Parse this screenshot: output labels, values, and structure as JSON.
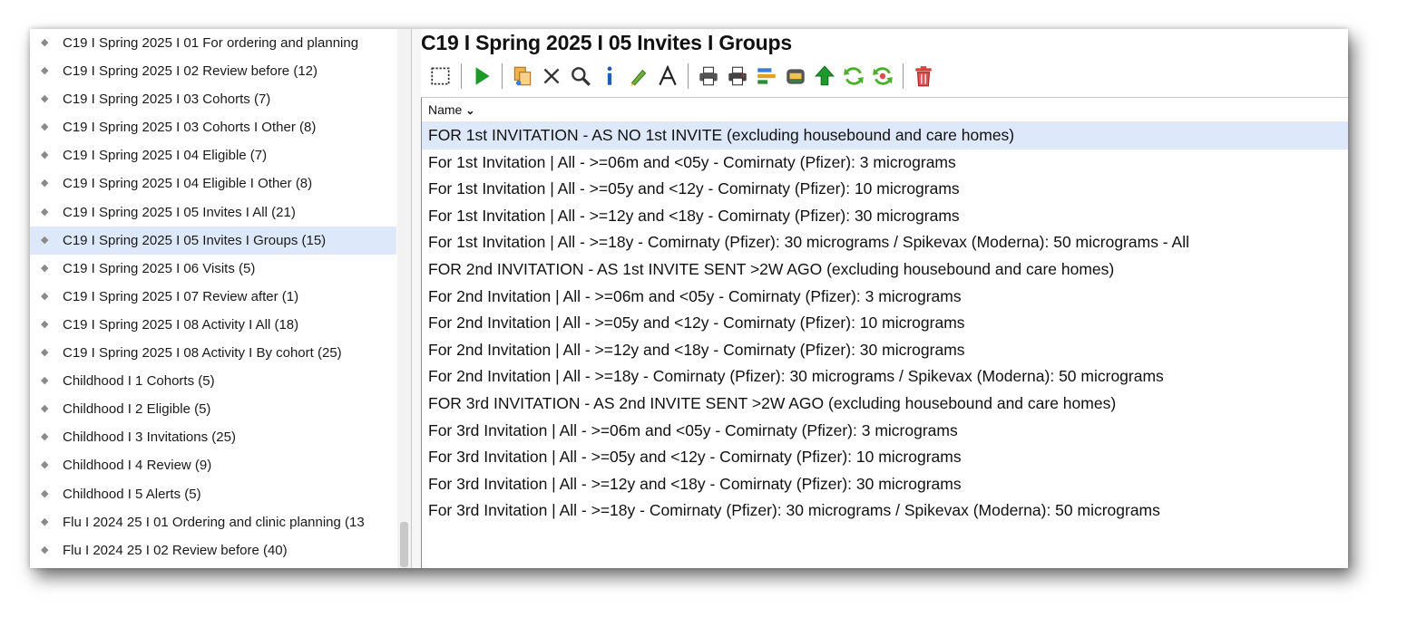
{
  "tree": {
    "items": [
      {
        "label": "C19 I Spring 2025 I 01 For ordering and planning"
      },
      {
        "label": "C19 I Spring 2025 I 02 Review before (12)"
      },
      {
        "label": "C19 I Spring 2025 I 03 Cohorts (7)"
      },
      {
        "label": "C19 I Spring 2025 I 03 Cohorts I Other (8)"
      },
      {
        "label": "C19 I Spring 2025 I 04 Eligible (7)"
      },
      {
        "label": "C19 I Spring 2025 I 04 Eligible I Other (8)"
      },
      {
        "label": "C19 I Spring 2025 I 05 Invites I All (21)"
      },
      {
        "label": "C19 I Spring 2025 I 05 Invites I Groups (15)",
        "selected": true
      },
      {
        "label": "C19 I Spring 2025 I 06 Visits (5)"
      },
      {
        "label": "C19 I Spring 2025 I 07 Review after (1)"
      },
      {
        "label": "C19 I Spring 2025 I 08 Activity I All (18)"
      },
      {
        "label": "C19 I Spring 2025 I 08 Activity I By cohort (25)"
      },
      {
        "label": "Childhood I 1 Cohorts (5)"
      },
      {
        "label": "Childhood I 2 Eligible (5)"
      },
      {
        "label": "Childhood I 3 Invitations (25)"
      },
      {
        "label": "Childhood I 4 Review (9)"
      },
      {
        "label": "Childhood I 5 Alerts (5)"
      },
      {
        "label": "Flu I 2024 25 I 01 Ordering and clinic planning (13"
      },
      {
        "label": "Flu I 2024 25 I 02 Review before (40)"
      }
    ]
  },
  "main": {
    "title": "C19 I Spring 2025 I 05 Invites I Groups",
    "column_header": "Name",
    "rows": [
      {
        "name": "FOR 1st INVITATION - AS NO 1st INVITE (excluding housebound and care homes)",
        "selected": true
      },
      {
        "name": "For 1st Invitation | All -  >=06m and <05y - Comirnaty (Pfizer): 3 micrograms"
      },
      {
        "name": "For 1st Invitation | All - >=05y and <12y - Comirnaty (Pfizer): 10 micrograms"
      },
      {
        "name": "For 1st Invitation | All - >=12y and <18y - Comirnaty (Pfizer): 30 micrograms"
      },
      {
        "name": "For 1st Invitation | All - >=18y - Comirnaty (Pfizer): 30 micrograms / Spikevax (Moderna): 50 micrograms - All"
      },
      {
        "name": "FOR 2nd INVITATION - AS 1st INVITE SENT >2W AGO (excluding housebound and care homes)"
      },
      {
        "name": "For 2nd Invitation | All -  >=06m and <05y - Comirnaty (Pfizer): 3 micrograms"
      },
      {
        "name": "For 2nd Invitation | All - >=05y and <12y - Comirnaty (Pfizer): 10 micrograms"
      },
      {
        "name": "For 2nd Invitation | All - >=12y and <18y - Comirnaty (Pfizer): 30 micrograms"
      },
      {
        "name": "For 2nd Invitation | All - >=18y - Comirnaty (Pfizer): 30 micrograms / Spikevax (Moderna): 50 micrograms"
      },
      {
        "name": "FOR 3rd INVITATION - AS 2nd INVITE SENT >2W AGO (excluding housebound and care homes)"
      },
      {
        "name": "For 3rd Invitation | All -  >=06m and <05y - Comirnaty (Pfizer): 3 micrograms"
      },
      {
        "name": "For 3rd Invitation | All - >=05y and <12y - Comirnaty (Pfizer): 10 micrograms"
      },
      {
        "name": "For 3rd Invitation | All - >=12y and <18y - Comirnaty (Pfizer): 30 micrograms"
      },
      {
        "name": "For 3rd Invitation | All - >=18y - Comirnaty (Pfizer): 30 micrograms / Spikevax (Moderna): 50 micrograms"
      }
    ]
  },
  "icons": [
    "select-icon",
    "run-icon",
    "copy-icon",
    "delete-x-icon",
    "search-icon",
    "info-icon",
    "edit-pen-icon",
    "font-icon",
    "print-icon",
    "print-alt-icon",
    "export-icon",
    "print-preview-icon",
    "move-up-icon",
    "refresh-icon",
    "refresh-all-icon",
    "trash-icon"
  ],
  "colors": {
    "selection": "#dde8fb",
    "run_green": "#1f9a2a",
    "trash_red": "#d83a3a",
    "info_blue": "#1c5fb8"
  }
}
